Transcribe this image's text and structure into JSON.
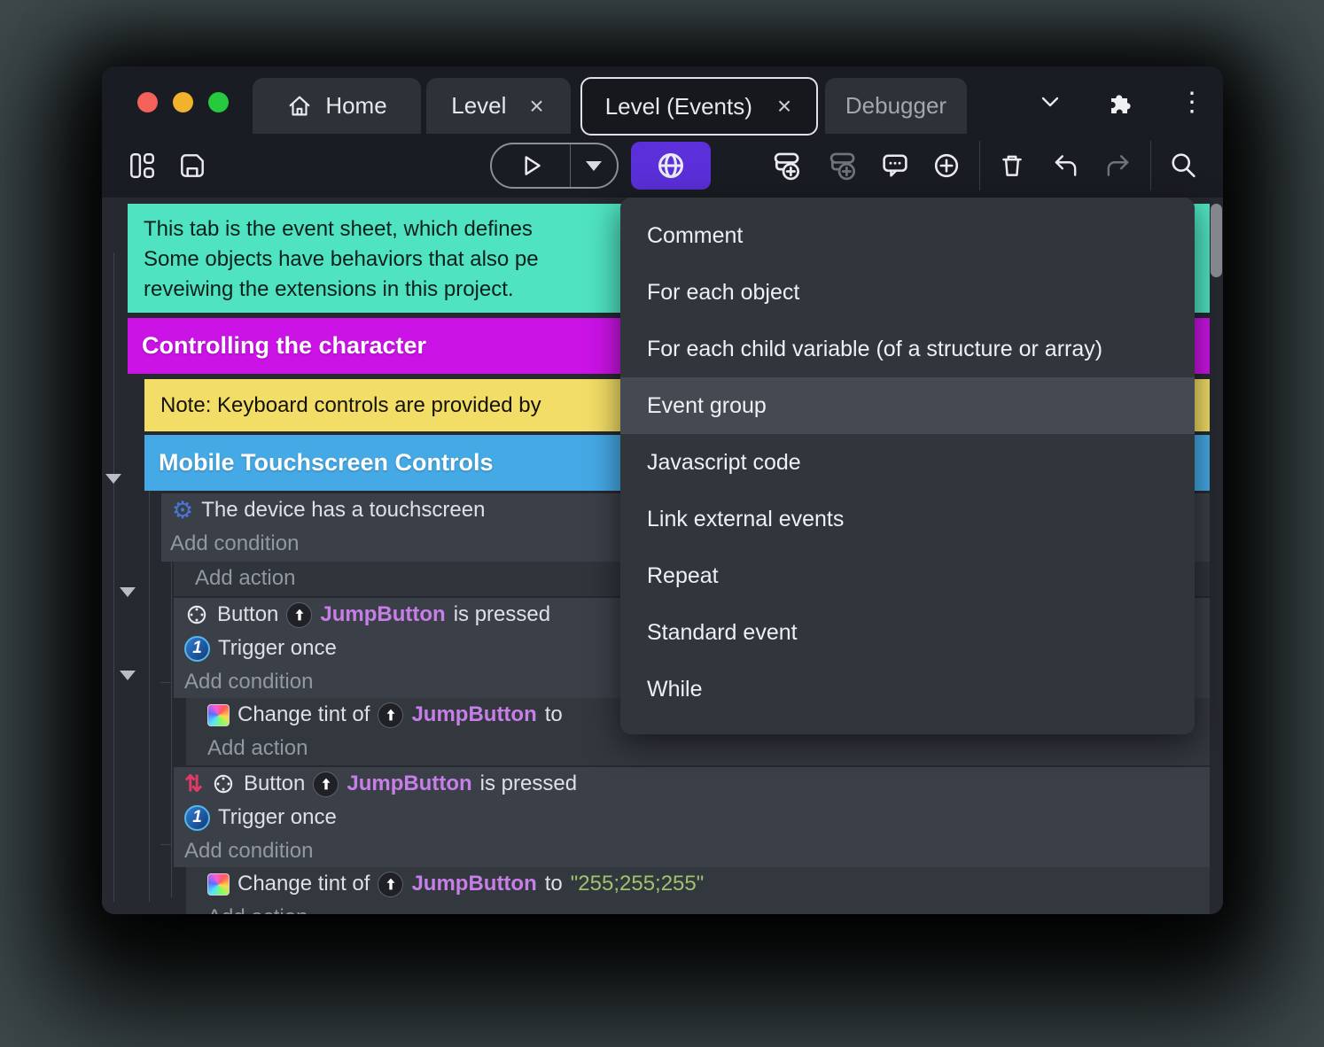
{
  "colors": {
    "accent_purple": "#5B2FD9",
    "comment_teal": "#4FE3C1",
    "group_magenta": "#CB13E6",
    "note_yellow": "#F2DD66",
    "group_blue": "#45A9E5",
    "object_purple": "#C77FE8",
    "string_green": "#9FC36D",
    "menu_bg": "#31353C",
    "menu_highlight": "#454A52"
  },
  "icons": {
    "gear": "⚙",
    "invert": "⇅",
    "kebab": "⋮",
    "close": "×",
    "one": "1"
  },
  "titlebar": {
    "tabs": [
      {
        "label": "Home"
      },
      {
        "label": "Level"
      },
      {
        "label": "Level (Events)"
      },
      {
        "label": "Debugger"
      }
    ]
  },
  "menu": {
    "selected": "Event group",
    "items": [
      "Comment",
      "For each object",
      "For each child variable (of a structure or array)",
      "Event group",
      "Javascript code",
      "Link external events",
      "Repeat",
      "Standard event",
      "While"
    ]
  },
  "sheet": {
    "comment_lines": [
      "This tab is the event sheet, which defines",
      "Some objects have behaviors that also pe",
      "reveiwing the extensions in this project."
    ],
    "group_controlling": "Controlling the character",
    "note": "Note: Keyboard controls are provided by",
    "group_mobile": "Mobile Touchscreen Controls",
    "device_condition": "The device has a touchscreen",
    "add_condition": "Add condition",
    "add_action": "Add action",
    "trigger_once": "Trigger once",
    "button_prefix": "Button",
    "object_name": "JumpButton",
    "pressed_suffix": "is pressed",
    "tint_prefix": "Change tint of",
    "to_word": "to",
    "tint_value": "\"255;255;255\""
  }
}
